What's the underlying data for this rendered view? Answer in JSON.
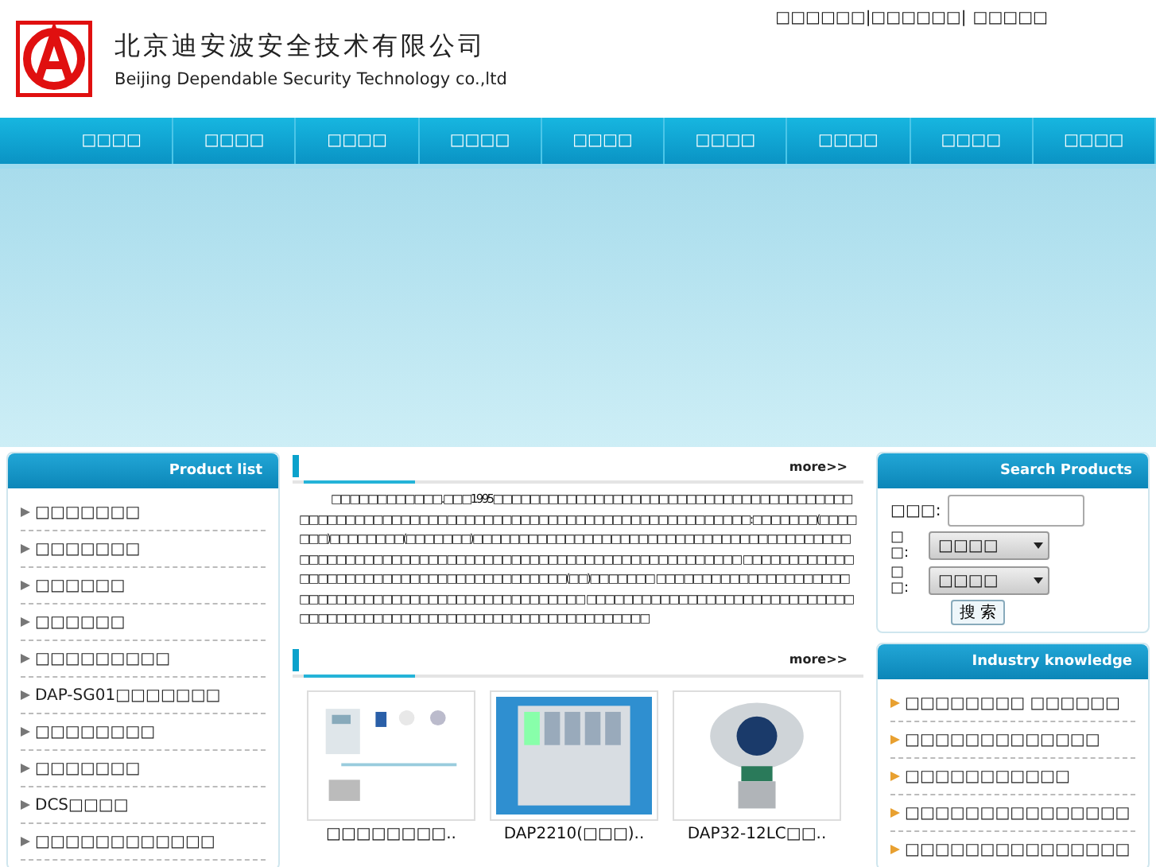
{
  "logo": {
    "name_cn": "北京迪安波安全技术有限公司",
    "name_en": "Beijing Dependable Security Technology co.,ltd"
  },
  "top_links": [
    "□□□□□□|□□□□□□|",
    "□□□□□"
  ],
  "nav": [
    "□□□□",
    "□□□□",
    "□□□□",
    "□□□□",
    "□□□□",
    "□□□□",
    "□□□□",
    "□□□□",
    "□□□□"
  ],
  "product_list": {
    "title": "Product list",
    "items": [
      "□□□□□□□",
      "□□□□□□□",
      "□□□□□□",
      "□□□□□□",
      "□□□□□□□□□",
      "DAP-SG01□□□□□□□",
      "□□□□□□□□",
      "□□□□□□□",
      "DCS□□□□",
      "□□□□□□□□□□□□"
    ]
  },
  "about": {
    "more": "more>>",
    "text": "□□□□□□□□□□□□.□□□1995□□□□□□□□□□□□□□□□□□□□□□□□□□□□□□□□□□□□□□□ □□□□□□□□□□□□□□□□□□□□□□□□□□□□□□□□□□□□□□□□□□□□□□□□□:□□□□□□□(□□□□□□□)□□□□□□□□(□□□□□□□)□□□□□□□□□□□□□□□□□□□□□□□□□□□□□□□□□□□□□□□□□□□□□□□□□□□□□□□□□□□□□□□□□□□□□□□□□□□□□□□□□□□□□□□□□ □□□□□□□□□□□□□□□□□□□□□□□□□□□□□□□□□□□□□□□□□(□□)□□□□□□□ □□□□□□□□□□□□□□□□□□□□□□□□□□□□□□□□□□□□□□□□□□□□□□□□□□□□ □□□□□□□□□□□□□□□□□□□□□□□□□□□□□□□□□□□□□□□□□□□□□□□□□□□□□□□□□□□□□□□□□□□"
  },
  "products": {
    "more": "more>>",
    "items": [
      {
        "name": "□□□□□□□□..",
        "kind": "diagram"
      },
      {
        "name": "DAP2210(□□□)..",
        "kind": "cabinet"
      },
      {
        "name": "DAP32-12LC□□..",
        "kind": "detector"
      }
    ]
  },
  "search": {
    "title": "Search Products",
    "keyword_label": "□□□:",
    "selects": [
      {
        "label": "□ □:",
        "value": "□□□□"
      },
      {
        "label": "□ □:",
        "value": "□□□□"
      }
    ],
    "button": "搜 索"
  },
  "knowledge": {
    "title": "Industry knowledge",
    "items": [
      "□□□□□□□□ □□□□□□",
      "□□□□□□□□□□□□□",
      "□□□□□□□□□□□",
      "□□□□□□□□□□□□□□□",
      "□□□□□□□□□□□□□□□"
    ]
  }
}
